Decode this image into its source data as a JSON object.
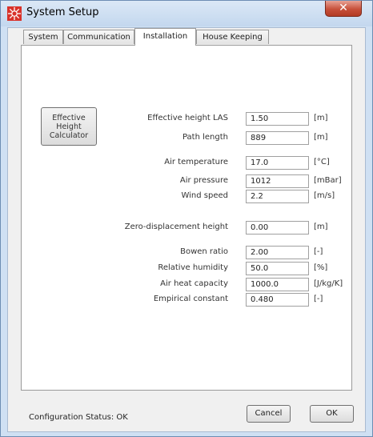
{
  "window": {
    "title": "System Setup",
    "close_symbol": "✕"
  },
  "tabs": [
    {
      "label": "System"
    },
    {
      "label": "Communication"
    },
    {
      "label": "Installation"
    },
    {
      "label": "House Keeping"
    }
  ],
  "active_tab": "Installation",
  "calculator_button": {
    "label": "Effective Height Calculator"
  },
  "fields": [
    {
      "label": "Effective height LAS",
      "value": "1.50",
      "unit": "[m]"
    },
    {
      "label": "Path length",
      "value": "889",
      "unit": "[m]"
    },
    {
      "label": "Air temperature",
      "value": "17.0",
      "unit": "[°C]"
    },
    {
      "label": "Air pressure",
      "value": "1012",
      "unit": "[mBar]"
    },
    {
      "label": "Wind speed",
      "value": "2.2",
      "unit": "[m/s]"
    },
    {
      "label": "Zero-displacement height",
      "value": "0.00",
      "unit": "[m]"
    },
    {
      "label": "Bowen ratio",
      "value": "2.00",
      "unit": "[-]"
    },
    {
      "label": "Relative humidity",
      "value": "50.0",
      "unit": "[%]"
    },
    {
      "label": "Air heat capacity",
      "value": "1000.0",
      "unit": "[J/kg/K]"
    },
    {
      "label": "Empirical constant",
      "value": "0.480",
      "unit": "[-]"
    }
  ],
  "status": {
    "text": "Configuration Status:  OK"
  },
  "buttons": {
    "cancel": "Cancel",
    "ok": "OK"
  },
  "icons": {
    "app": "sun-settings-icon",
    "close": "close-icon"
  },
  "colors": {
    "close_button": "#c7503a",
    "titlebar": "#c3d7ee",
    "app_icon": "#d9322a"
  }
}
